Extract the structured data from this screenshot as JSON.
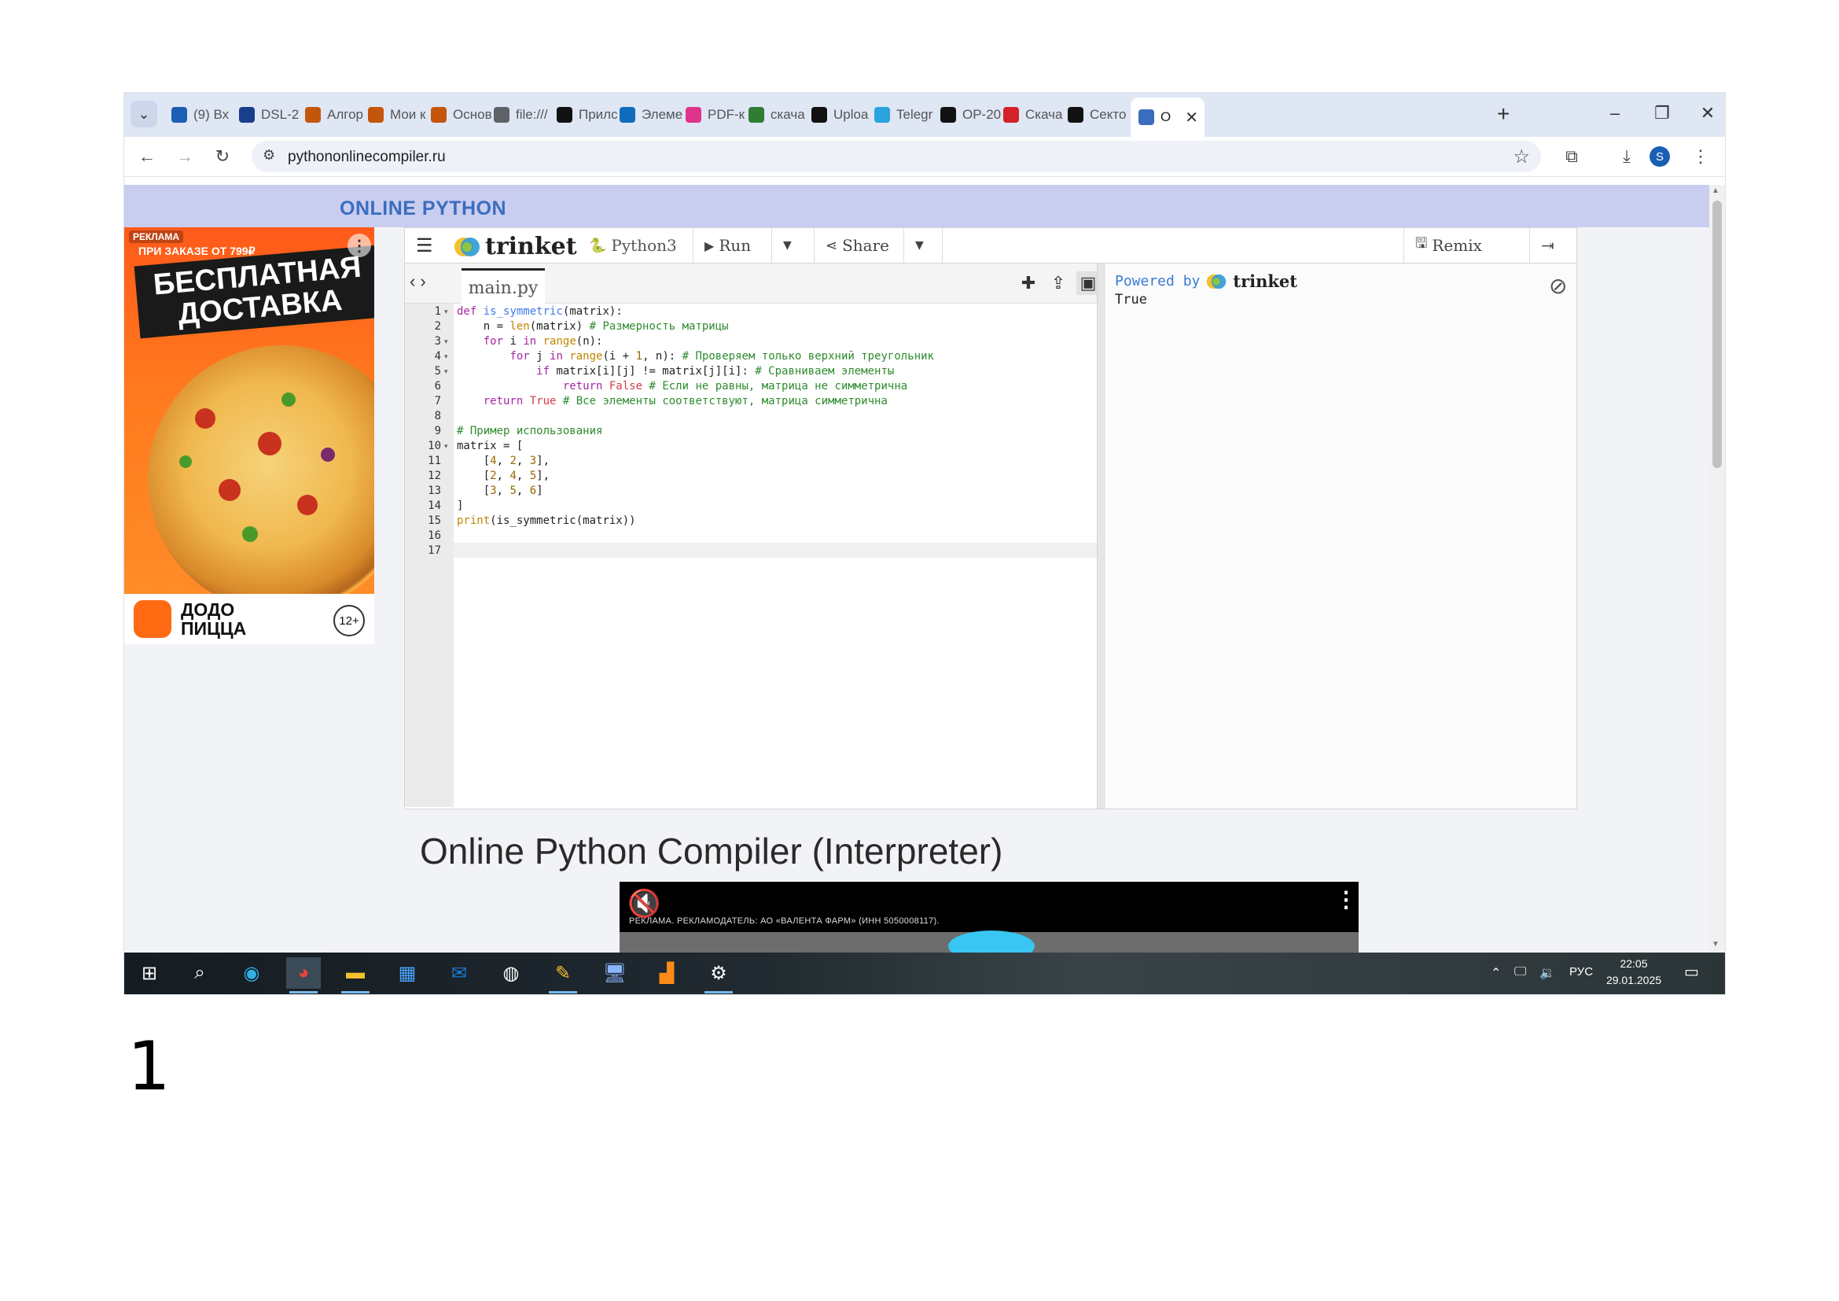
{
  "browser": {
    "tabs": [
      {
        "title": "(9) Вх",
        "icon": "mail-icon",
        "color": "#1a5fb4"
      },
      {
        "title": "DSL-2",
        "icon": "d-link-icon",
        "color": "#1a3f8a"
      },
      {
        "title": "Алгор",
        "icon": "mooc-icon",
        "color": "#c4560b"
      },
      {
        "title": "Мои к",
        "icon": "mooc-icon",
        "color": "#c4560b"
      },
      {
        "title": "Основ",
        "icon": "mooc-icon",
        "color": "#c4560b"
      },
      {
        "title": "file:///",
        "icon": "globe-icon",
        "color": "#5f6368"
      },
      {
        "title": "Прилс",
        "icon": "github-icon",
        "color": "#111111"
      },
      {
        "title": "Элеме",
        "icon": "onedrive-icon",
        "color": "#0f6cbd"
      },
      {
        "title": "PDF-к",
        "icon": "pdf-tool-icon",
        "color": "#e0338a"
      },
      {
        "title": "скача",
        "icon": "download-site-icon",
        "color": "#2f7d32"
      },
      {
        "title": "Uploa",
        "icon": "github-icon",
        "color": "#111111"
      },
      {
        "title": "Telegr",
        "icon": "telegram-icon",
        "color": "#2aa3df"
      },
      {
        "title": "OP-20",
        "icon": "github-icon",
        "color": "#111111"
      },
      {
        "title": "Скача",
        "icon": "opera-icon",
        "color": "#d3222a"
      },
      {
        "title": "Секто",
        "icon": "sector-icon",
        "color": "#111111"
      },
      {
        "title": "О",
        "icon": "compiler-icon",
        "color": "#3b6dbf",
        "active": true
      }
    ],
    "url": "pythononlinecompiler.ru",
    "profile_initial": "S"
  },
  "page": {
    "banner_title": "ONLINE PYTHON",
    "heading": "Online Python Compiler (Interpreter)"
  },
  "ad": {
    "tag": "РЕКЛАМА",
    "promo": "ПРИ ЗАКАЗЕ ОТ 799₽",
    "headline_1": "БЕСПЛАТНАЯ",
    "headline_2": "ДОСТАВКА",
    "brand_1": "ДОДО",
    "brand_2": "ПИЦЦА",
    "age": "12+"
  },
  "trinket": {
    "logo": "trinket",
    "language": "Python3",
    "run_label": "Run",
    "share_label": "Share",
    "remix_label": "Remix",
    "file_tab": "main.py",
    "powered_by": "Powered by",
    "output": "True",
    "code": [
      "def is_symmetric(matrix):",
      "    n = len(matrix) # Размерность матрицы",
      "    for i in range(n):",
      "        for j in range(i + 1, n): # Проверяем только верхний треугольник",
      "            if matrix[i][j] != matrix[j][i]: # Сравниваем элементы",
      "                return False # Если не равны, матрица не симметрична",
      "    return True # Все элементы соответствуют, матрица симметрична",
      "",
      "# Пример использования",
      "matrix = [",
      "    [4, 2, 3],",
      "    [2, 4, 5],",
      "    [3, 5, 6]",
      "]",
      "print(is_symmetric(matrix))",
      "",
      ""
    ],
    "line_numbers": [
      "1",
      "2",
      "3",
      "4",
      "5",
      "6",
      "7",
      "8",
      "9",
      "10",
      "11",
      "12",
      "13",
      "14",
      "15",
      "16",
      "17"
    ]
  },
  "video_ad": {
    "label": "РЕКЛАМА. РЕКЛАМОДАТЕЛЬ: АО «ВАЛЕНТА ФАРМ» (ИНН 5050008117)."
  },
  "taskbar": {
    "language": "РУС",
    "time": "22:05",
    "date": "29.01.2025"
  },
  "slide_number": "1"
}
